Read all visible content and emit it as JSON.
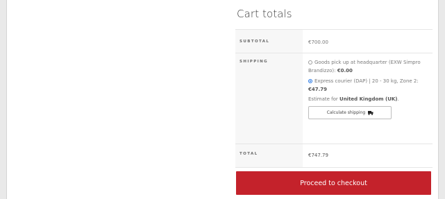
{
  "cart_totals": {
    "title": "Cart totals",
    "subtotal_label": "SUBTOTAL",
    "subtotal_value": "€700.00",
    "shipping_label": "SHIPPING",
    "shipping_options": [
      {
        "text": "Goods pick up at headquarter (EXW Simpro Brandizzo):",
        "price": "€0.00",
        "selected": false
      },
      {
        "text": "Express courier (DAP) | 20 - 30 kg, Zone 2:",
        "price": "€47.79",
        "selected": true
      }
    ],
    "estimate_prefix": "Estimate for",
    "estimate_country": "United Kingdom (UK)",
    "estimate_suffix": ".",
    "calculate_shipping_label": "Calculate shipping",
    "total_label": "TOTAL",
    "total_value": "€747.79",
    "checkout_label": "Proceed to checkout"
  },
  "colors": {
    "checkout_bg": "#c4222b",
    "radio_selected": "#2c7be5"
  },
  "icons": {
    "calculate_shipping": "truck-icon"
  }
}
